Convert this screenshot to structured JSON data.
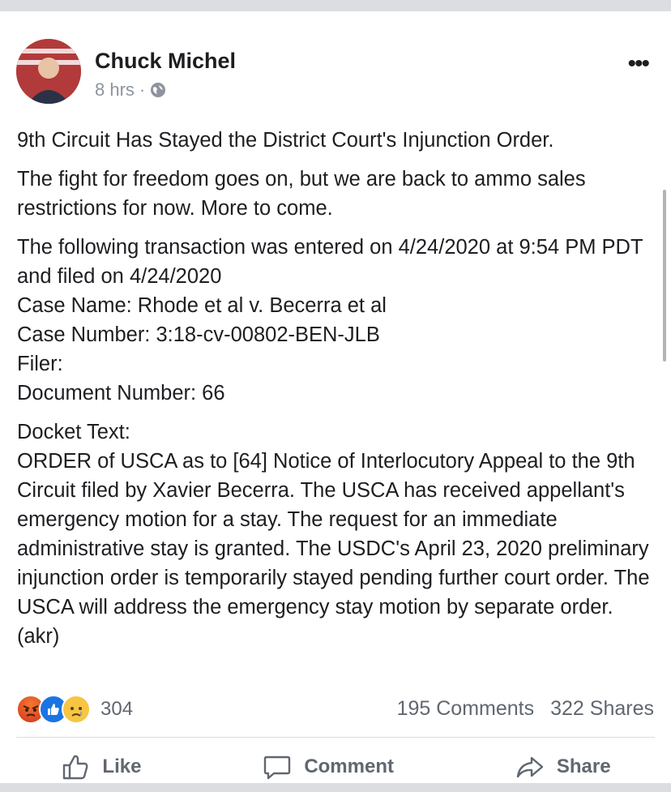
{
  "post": {
    "author": "Chuck Michel",
    "time": "8 hrs",
    "separator": "·",
    "privacy_icon": "globe-icon",
    "more_icon": "more-dots-icon",
    "paragraphs": [
      "9th Circuit Has Stayed the District Court's Injunction Order.",
      "The fight for freedom goes on, but we are back to ammo sales restrictions for now. More to come.",
      "The following transaction was entered on 4/24/2020 at 9:54 PM PDT and filed on 4/24/2020\nCase Name: Rhode et al v. Becerra et al\nCase Number: 3:18-cv-00802-BEN-JLB\nFiler:\nDocument Number: 66",
      "Docket Text:\nORDER of USCA as to [64] Notice of Interlocutory Appeal to the 9th Circuit filed by Xavier Becerra. The USCA has received appellant's emergency motion for a stay. The request for an immediate administrative stay is granted. The USDC's April 23, 2020 preliminary injunction order is temporarily stayed pending further court order. The USCA will address the emergency stay motion by separate order. (akr)"
    ]
  },
  "engagement": {
    "reaction_icons": [
      "angry-icon",
      "like-icon",
      "sad-icon"
    ],
    "reaction_count": "304",
    "comments": "195 Comments",
    "shares": "322 Shares"
  },
  "actions": {
    "like_label": "Like",
    "comment_label": "Comment",
    "share_label": "Share"
  },
  "colors": {
    "like_blue": "#1b74e4",
    "text_primary": "#1c1e21",
    "text_secondary": "#606770"
  }
}
